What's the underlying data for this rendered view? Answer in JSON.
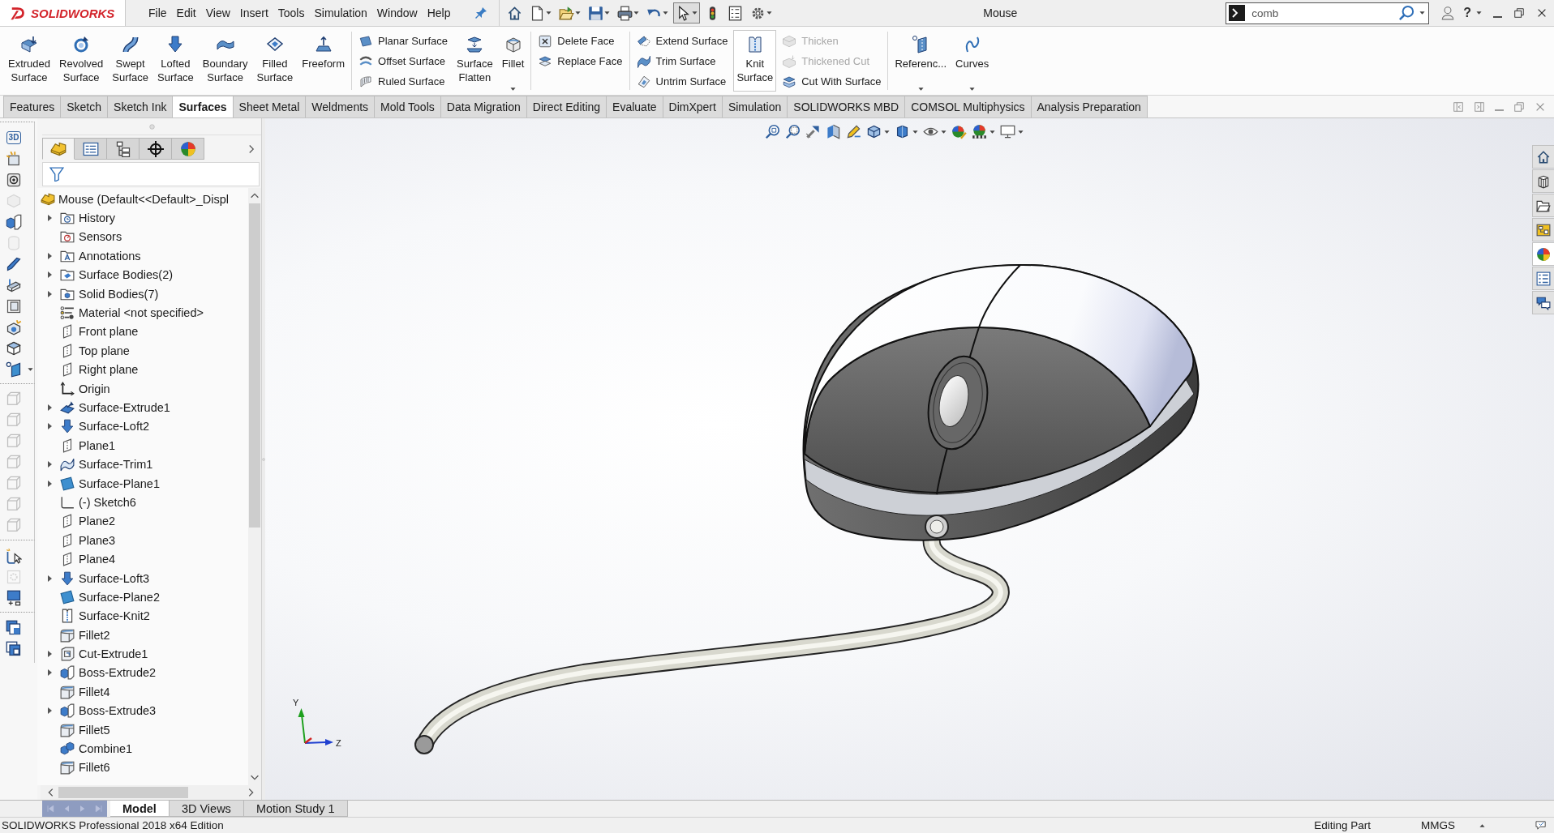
{
  "title_bar": {
    "logo": "SOLIDWORKS",
    "menu": [
      "File",
      "Edit",
      "View",
      "Insert",
      "Tools",
      "Simulation",
      "Window",
      "Help"
    ],
    "select_tool": {
      "selected": true
    },
    "title": "Mouse",
    "search": {
      "value": "comb"
    },
    "help": "?"
  },
  "ribbon": {
    "groups": [
      {
        "controls": [
          {
            "kind": "large",
            "label": "Extruded Surface",
            "has_menu": false,
            "highlighted": false
          },
          {
            "kind": "large",
            "label": "Revolved Surface",
            "has_menu": false,
            "highlighted": false
          },
          {
            "kind": "large",
            "label": "Swept Surface",
            "has_menu": false,
            "highlighted": false
          },
          {
            "kind": "large",
            "label": "Lofted Surface",
            "has_menu": false,
            "highlighted": false
          },
          {
            "kind": "large",
            "label": "Boundary Surface",
            "has_menu": false,
            "highlighted": false
          },
          {
            "kind": "large",
            "label": "Filled Surface",
            "has_menu": false,
            "highlighted": false
          },
          {
            "kind": "large",
            "label": "Freeform",
            "has_menu": false,
            "highlighted": false
          }
        ]
      },
      {
        "controls": [
          {
            "kind": "stack",
            "items": [
              {
                "label": "Planar Surface",
                "disabled": false
              },
              {
                "label": "Offset Surface",
                "disabled": false
              },
              {
                "label": "Ruled Surface",
                "disabled": false
              }
            ]
          },
          {
            "kind": "large",
            "label": "Surface Flatten",
            "has_menu": false,
            "highlighted": false
          },
          {
            "kind": "large",
            "label": "Fillet",
            "has_menu": true,
            "highlighted": false
          }
        ]
      },
      {
        "controls": [
          {
            "kind": "stack",
            "items": [
              {
                "label": "Delete Face",
                "disabled": false
              },
              {
                "label": "Replace Face",
                "disabled": false
              }
            ]
          }
        ]
      },
      {
        "controls": [
          {
            "kind": "stack",
            "items": [
              {
                "label": "Extend Surface",
                "disabled": false
              },
              {
                "label": "Trim Surface",
                "disabled": false
              },
              {
                "label": "Untrim Surface",
                "disabled": false
              }
            ]
          },
          {
            "kind": "large",
            "label": "Knit Surface",
            "has_menu": false,
            "highlighted": true
          },
          {
            "kind": "stack",
            "items": [
              {
                "label": "Thicken",
                "disabled": true
              },
              {
                "label": "Thickened Cut",
                "disabled": true
              },
              {
                "label": "Cut With Surface",
                "disabled": false
              }
            ]
          }
        ]
      },
      {
        "controls": [
          {
            "kind": "large",
            "label": "Referenc...",
            "has_menu": true,
            "highlighted": false
          },
          {
            "kind": "large",
            "label": "Curves",
            "has_menu": true,
            "highlighted": false
          }
        ]
      }
    ]
  },
  "command_tabs": [
    {
      "label": "Features",
      "selected": false
    },
    {
      "label": "Sketch",
      "selected": false
    },
    {
      "label": "Sketch Ink",
      "selected": false
    },
    {
      "label": "Surfaces",
      "selected": true
    },
    {
      "label": "Sheet Metal",
      "selected": false
    },
    {
      "label": "Weldments",
      "selected": false
    },
    {
      "label": "Mold Tools",
      "selected": false
    },
    {
      "label": "Data Migration",
      "selected": false
    },
    {
      "label": "Direct Editing",
      "selected": false
    },
    {
      "label": "Evaluate",
      "selected": false
    },
    {
      "label": "DimXpert",
      "selected": false
    },
    {
      "label": "Simulation",
      "selected": false
    },
    {
      "label": "SOLIDWORKS MBD",
      "selected": false
    },
    {
      "label": "COMSOL Multiphysics",
      "selected": false
    },
    {
      "label": "Analysis Preparation",
      "selected": false
    }
  ],
  "left_toolbar": {
    "groups": [
      {
        "tools": [
          {
            "label": "3D",
            "disabled": false
          },
          {
            "disabled": false
          },
          {
            "disabled": false
          },
          {
            "disabled": true
          },
          {
            "disabled": false
          },
          {
            "disabled": true
          },
          {
            "disabled": false
          },
          {
            "disabled": false
          },
          {
            "disabled": false
          },
          {
            "disabled": false
          },
          {
            "disabled": false
          },
          {
            "disabled": false
          }
        ]
      },
      {
        "tools": [
          {
            "disabled": true
          },
          {
            "disabled": true
          },
          {
            "disabled": true
          },
          {
            "disabled": true
          },
          {
            "disabled": true
          },
          {
            "disabled": true
          },
          {
            "disabled": true
          }
        ]
      },
      {
        "tools": [
          {
            "disabled": false
          },
          {
            "disabled": true
          },
          {
            "disabled": false
          }
        ]
      },
      {
        "tools": [
          {
            "disabled": false
          },
          {
            "disabled": false
          }
        ]
      }
    ]
  },
  "feature_manager": {
    "tabs": [
      {
        "kind": "feature-tree",
        "selected": true
      },
      {
        "kind": "property",
        "selected": false
      },
      {
        "kind": "configuration",
        "selected": false
      },
      {
        "kind": "dimxpert",
        "selected": false
      },
      {
        "kind": "display",
        "selected": false
      }
    ],
    "tree": {
      "label": "Mouse (Default<<Default>_Displ",
      "kind": "part",
      "children": [
        {
          "label": "History",
          "kind": "history-folder",
          "expandable": true
        },
        {
          "label": "Sensors",
          "kind": "sensors-folder",
          "expandable": false
        },
        {
          "label": "Annotations",
          "kind": "annotations-folder",
          "expandable": true
        },
        {
          "label": "Surface Bodies(2)",
          "kind": "surface-bodies-folder",
          "expandable": true
        },
        {
          "label": "Solid Bodies(7)",
          "kind": "solid-bodies-folder",
          "expandable": true
        },
        {
          "label": "Material <not specified>",
          "kind": "material",
          "expandable": false
        },
        {
          "label": "Front plane",
          "kind": "plane",
          "expandable": false
        },
        {
          "label": "Top plane",
          "kind": "plane",
          "expandable": false
        },
        {
          "label": "Right plane",
          "kind": "plane",
          "expandable": false
        },
        {
          "label": "Origin",
          "kind": "origin",
          "expandable": false
        },
        {
          "label": "Surface-Extrude1",
          "kind": "surface-extrude",
          "expandable": true
        },
        {
          "label": "Surface-Loft2",
          "kind": "surface-loft",
          "expandable": true
        },
        {
          "label": "Plane1",
          "kind": "plane",
          "expandable": false
        },
        {
          "label": "Surface-Trim1",
          "kind": "surface-trim",
          "expandable": true
        },
        {
          "label": "Surface-Plane1",
          "kind": "surface-plane",
          "expandable": true
        },
        {
          "label": "(-) Sketch6",
          "kind": "sketch",
          "expandable": false
        },
        {
          "label": "Plane2",
          "kind": "plane",
          "expandable": false
        },
        {
          "label": "Plane3",
          "kind": "plane",
          "expandable": false
        },
        {
          "label": "Plane4",
          "kind": "plane",
          "expandable": false
        },
        {
          "label": "Surface-Loft3",
          "kind": "surface-loft",
          "expandable": true
        },
        {
          "label": "Surface-Plane2",
          "kind": "surface-plane",
          "expandable": false
        },
        {
          "label": "Surface-Knit2",
          "kind": "surface-knit",
          "expandable": false
        },
        {
          "label": "Fillet2",
          "kind": "fillet",
          "expandable": false
        },
        {
          "label": "Cut-Extrude1",
          "kind": "cut-extrude",
          "expandable": true
        },
        {
          "label": "Boss-Extrude2",
          "kind": "boss-extrude",
          "expandable": true
        },
        {
          "label": "Fillet4",
          "kind": "fillet",
          "expandable": false
        },
        {
          "label": "Boss-Extrude3",
          "kind": "boss-extrude",
          "expandable": true
        },
        {
          "label": "Fillet5",
          "kind": "fillet",
          "expandable": false
        },
        {
          "label": "Combine1",
          "kind": "combine",
          "expandable": false
        },
        {
          "label": "Fillet6",
          "kind": "fillet",
          "expandable": false
        }
      ]
    }
  },
  "graphics": {
    "task_pane": [
      {
        "selected": false
      },
      {
        "selected": false
      },
      {
        "selected": false
      },
      {
        "selected": false
      },
      {
        "selected": true
      },
      {
        "selected": false
      },
      {
        "selected": false
      }
    ],
    "triad": {
      "axes": [
        "Y",
        "Z"
      ]
    }
  },
  "bottom_tabs": {
    "navigation": {
      "disabled": true
    },
    "tabs": [
      {
        "label": "Model",
        "selected": true
      },
      {
        "label": "3D Views",
        "selected": false
      },
      {
        "label": "Motion Study 1",
        "selected": false
      }
    ]
  },
  "status_bar": {
    "product": "SOLIDWORKS Professional 2018 x64 Edition",
    "mode": "Editing Part",
    "units": "MMGS"
  }
}
